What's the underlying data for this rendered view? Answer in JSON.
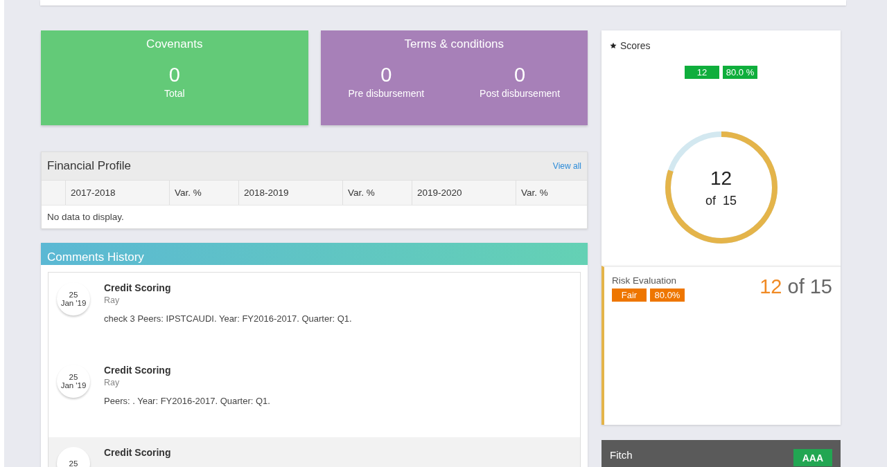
{
  "covenants": {
    "title": "Covenants",
    "stats": [
      {
        "value": "0",
        "label": "Total"
      }
    ]
  },
  "terms": {
    "title": "Terms & conditions",
    "stats": [
      {
        "value": "0",
        "label": "Pre disbursement"
      },
      {
        "value": "0",
        "label": "Post disbursement"
      }
    ]
  },
  "financial_profile": {
    "title": "Financial Profile",
    "link": "View all",
    "columns": [
      "2017-2018",
      "Var. %",
      "2018-2019",
      "Var. %",
      "2019-2020",
      "Var. %"
    ],
    "empty": "No data to display."
  },
  "comments": {
    "title": "Comments History",
    "items": [
      {
        "day": "25",
        "month": "Jan '19",
        "title": "Credit Scoring",
        "author": "Ray",
        "text": "check 3 Peers: IPSTCAUDI. Year: FY2016-2017. Quarter: Q1.",
        "selected": false
      },
      {
        "day": "25",
        "month": "Jan '19",
        "title": "Credit Scoring",
        "author": "Ray",
        "text": "Peers: . Year: FY2016-2017. Quarter: Q1.",
        "selected": false
      },
      {
        "day": "25",
        "title": "Credit Scoring",
        "selected": true
      }
    ]
  },
  "scores": {
    "title": "Scores",
    "badges": [
      "12",
      "80.0 %"
    ],
    "ring": {
      "value": "12",
      "of": "of",
      "total": "15"
    }
  },
  "risk": {
    "title": "Risk Evaluation",
    "badges": [
      "Fair",
      "80.0%"
    ],
    "score": "12",
    "of": "of 15"
  },
  "fitch": {
    "title": "Fitch",
    "rating": "AAA"
  }
}
